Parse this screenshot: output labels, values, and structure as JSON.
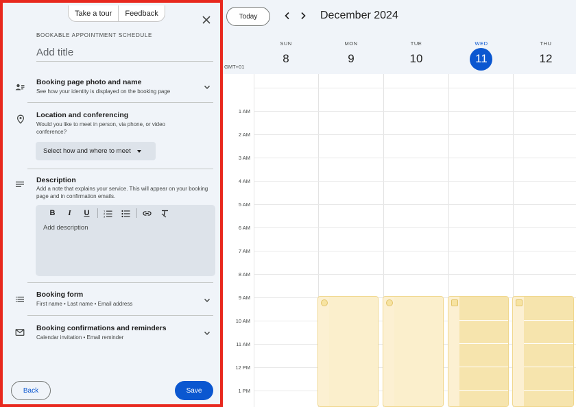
{
  "panel": {
    "tour_label": "Take a tour",
    "feedback_label": "Feedback",
    "kicker": "BOOKABLE APPOINTMENT SCHEDULE",
    "title_placeholder": "Add title",
    "sections": {
      "booking_page": {
        "title": "Booking page photo and name",
        "subtitle": "See how your identity is displayed on the booking page"
      },
      "location": {
        "title": "Location and conferencing",
        "subtitle": "Would you like to meet in person, via phone, or video conference?",
        "select_label": "Select how and where to meet"
      },
      "description": {
        "title": "Description",
        "subtitle": "Add a note that explains your service. This will appear on your booking page and in confirmation emails.",
        "placeholder": "Add description"
      },
      "booking_form": {
        "title": "Booking form",
        "subtitle": "First name • Last name • Email address"
      },
      "confirmations": {
        "title": "Booking confirmations and reminders",
        "subtitle": "Calendar invitation • Email reminder"
      }
    },
    "toolbar": {
      "bold": "B",
      "italic": "I",
      "underline": "U"
    },
    "back_label": "Back",
    "save_label": "Save",
    "accent": "#0b57d0",
    "highlight_border": "#e8281e"
  },
  "calendar": {
    "today_label": "Today",
    "month_label": "December 2024",
    "timezone": "GMT+01",
    "days": [
      {
        "dow": "SUN",
        "num": "8"
      },
      {
        "dow": "MON",
        "num": "9"
      },
      {
        "dow": "TUE",
        "num": "10"
      },
      {
        "dow": "WED",
        "num": "11"
      },
      {
        "dow": "THU",
        "num": "12"
      }
    ],
    "hours": [
      "1 AM",
      "2 AM",
      "3 AM",
      "4 AM",
      "5 AM",
      "6 AM",
      "7 AM",
      "8 AM",
      "9 AM",
      "10 AM",
      "11 AM",
      "12 PM",
      "1 PM"
    ],
    "today_color": "#0b57d0",
    "block_color": "#fcf0d2"
  }
}
